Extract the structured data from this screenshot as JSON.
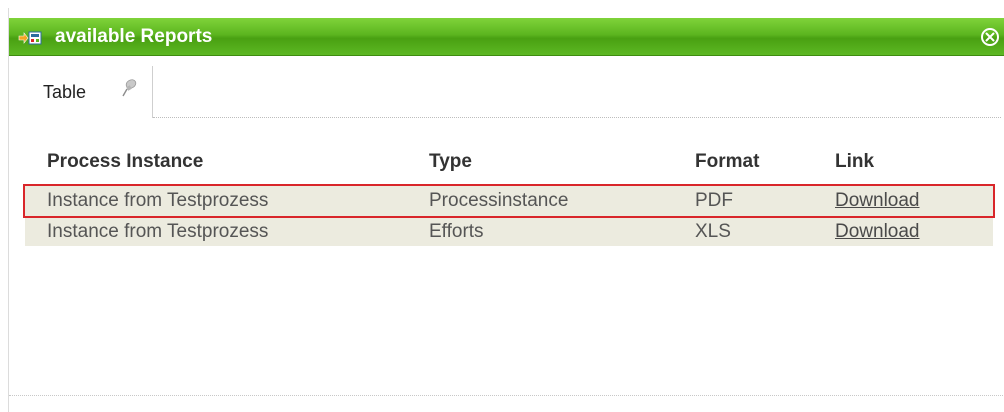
{
  "window": {
    "title": "available Reports",
    "accent_color": "#5cb51f",
    "title_icon": "report-arrow-icon",
    "close_icon": "close-icon"
  },
  "tabs": [
    {
      "label": "Table",
      "icon": "pin-icon",
      "active": true
    }
  ],
  "table": {
    "columns": [
      "Process Instance",
      "Type",
      "Format",
      "Link"
    ],
    "rows": [
      {
        "process_instance": "Instance from Testprozess",
        "type": "Processinstance",
        "format": "PDF",
        "link": "Download",
        "selected": true
      },
      {
        "process_instance": "Instance from Testprozess",
        "type": "Efforts",
        "format": "XLS",
        "link": "Download",
        "selected": false
      }
    ],
    "row_color": "#ecebdf",
    "selection_color": "#d9262a"
  }
}
